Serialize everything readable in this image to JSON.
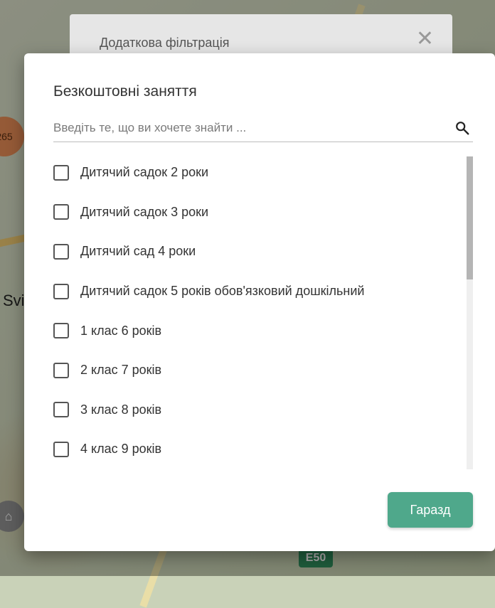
{
  "map": {
    "cluster_count": "265",
    "place_label": "Svi",
    "road_shield": "E50"
  },
  "back_dialog": {
    "title": "Додаткова фільтрація",
    "close_glyph": "✕"
  },
  "dialog": {
    "title": "Безкоштовні заняття",
    "search_placeholder": "Введіть те, що ви хочете знайти ...",
    "items": [
      {
        "label": "Дитячий садок 2 роки",
        "checked": false
      },
      {
        "label": "Дитячий садок 3 роки",
        "checked": false
      },
      {
        "label": "Дитячий сад 4 роки",
        "checked": false
      },
      {
        "label": "Дитячий садок 5 років обов'язковий дошкільний",
        "checked": false
      },
      {
        "label": "1 клас 6 років",
        "checked": false
      },
      {
        "label": "2 клас 7 років",
        "checked": false
      },
      {
        "label": "3 клас 8 років",
        "checked": false
      },
      {
        "label": "4 клас 9 років",
        "checked": false
      }
    ],
    "ok_label": "Гаразд"
  },
  "colors": {
    "accent": "#4fa88b"
  }
}
